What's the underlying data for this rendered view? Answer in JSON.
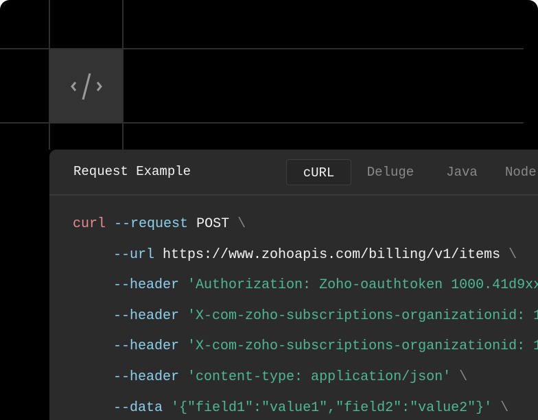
{
  "icon": "code-brackets-icon",
  "panel": {
    "title": "Request Example",
    "tabs": [
      {
        "label": "cURL",
        "active": true
      },
      {
        "label": "Deluge",
        "active": false
      },
      {
        "label": "Java",
        "active": false
      },
      {
        "label": "Node",
        "active": false
      }
    ]
  },
  "code": {
    "l1": {
      "cmd": "curl",
      "flag": "--request",
      "value": "POST",
      "cont": "\\"
    },
    "l2": {
      "flag": "--url",
      "value": "https://www.zohoapis.com/billing/v1/items",
      "cont": "\\"
    },
    "l3": {
      "flag": "--header",
      "str": "'Authorization: Zoho-oauthtoken 1000.41d9xx"
    },
    "l4": {
      "flag": "--header",
      "str": "'X-com-zoho-subscriptions-organizationid: 1"
    },
    "l5": {
      "flag": "--header",
      "str": "'X-com-zoho-subscriptions-organizationid: 1"
    },
    "l6": {
      "flag": "--header",
      "str": "'content-type: application/json'",
      "cont": "\\"
    },
    "l7": {
      "flag": "--data",
      "str": "'{\"field1\":\"value1\",\"field2\":\"value2\"}'",
      "cont": "\\"
    }
  },
  "colors": {
    "command": "#e58b8b",
    "flag": "#8dd0ee",
    "string": "#4fb891",
    "background": "#2b2b2b"
  }
}
